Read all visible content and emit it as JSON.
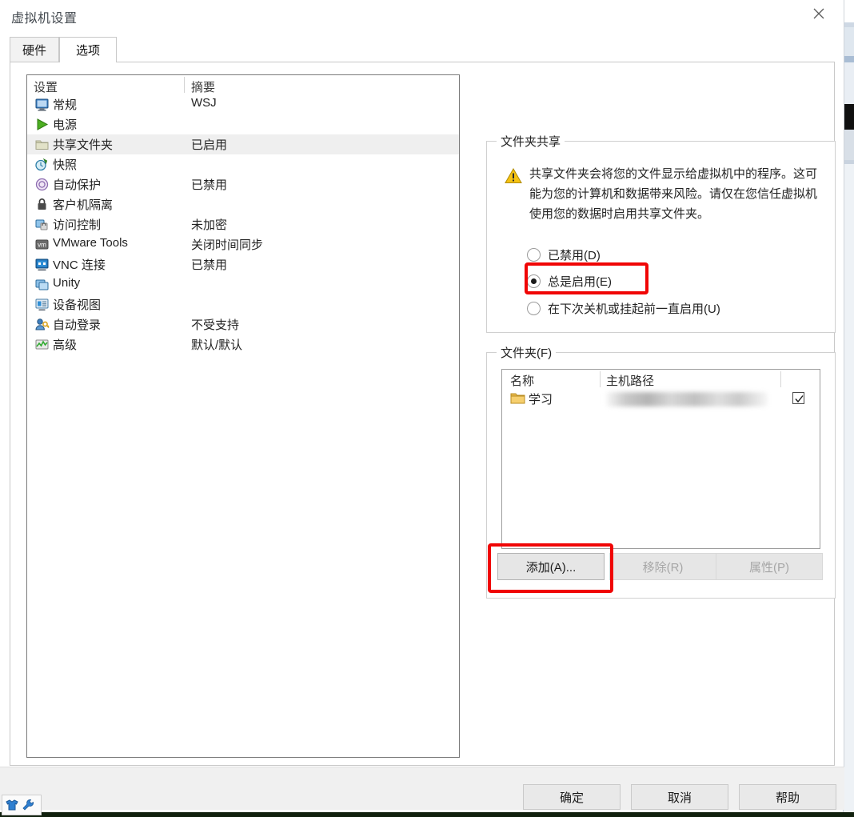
{
  "window": {
    "title": "虚拟机设置",
    "close_label": "✕"
  },
  "tabs": [
    {
      "label": "硬件",
      "active": false
    },
    {
      "label": "选项",
      "active": true
    }
  ],
  "settings_list": {
    "columns": [
      "设置",
      "摘要"
    ],
    "rows": [
      {
        "icon": "monitor-icon",
        "name": "常规",
        "summary": "WSJ",
        "selected": false
      },
      {
        "icon": "power-play-icon",
        "name": "电源",
        "summary": "",
        "selected": false
      },
      {
        "icon": "shared-folder-icon",
        "name": "共享文件夹",
        "summary": "已启用",
        "selected": true
      },
      {
        "icon": "snapshot-clock-icon",
        "name": "快照",
        "summary": "",
        "selected": false
      },
      {
        "icon": "autoprotect-icon",
        "name": "自动保护",
        "summary": "已禁用",
        "selected": false
      },
      {
        "icon": "lock-icon",
        "name": "客户机隔离",
        "summary": "",
        "selected": false
      },
      {
        "icon": "access-control-icon",
        "name": "访问控制",
        "summary": "未加密",
        "selected": false
      },
      {
        "icon": "vmware-tools-icon",
        "name": "VMware Tools",
        "summary": "关闭时间同步",
        "selected": false
      },
      {
        "icon": "vnc-monitor-icon",
        "name": "VNC 连接",
        "summary": "已禁用",
        "selected": false
      },
      {
        "icon": "unity-windows-icon",
        "name": "Unity",
        "summary": "",
        "selected": false
      },
      {
        "icon": "device-view-icon",
        "name": "设备视图",
        "summary": "",
        "selected": false
      },
      {
        "icon": "autologon-key-icon",
        "name": "自动登录",
        "summary": "不受支持",
        "selected": false
      },
      {
        "icon": "advanced-chart-icon",
        "name": "高级",
        "summary": "默认/默认",
        "selected": false
      }
    ]
  },
  "folder_sharing": {
    "legend": "文件夹共享",
    "warning_icon": "warning-triangle-icon",
    "warning_text": "共享文件夹会将您的文件显示给虚拟机中的程序。这可能为您的计算机和数据带来风险。请仅在您信任虚拟机使用您的数据时启用共享文件夹。",
    "options": [
      {
        "label": "已禁用(D)",
        "selected": false
      },
      {
        "label": "总是启用(E)",
        "selected": true
      },
      {
        "label": "在下次关机或挂起前一直启用(U)",
        "selected": false
      }
    ]
  },
  "folders": {
    "legend": "文件夹(F)",
    "columns": [
      "名称",
      "主机路径"
    ],
    "rows": [
      {
        "icon": "folder-icon",
        "name": "学习",
        "host_path": "",
        "enabled": true
      }
    ],
    "buttons": [
      {
        "label": "添加(A)...",
        "enabled": true
      },
      {
        "label": "移除(R)",
        "enabled": false
      },
      {
        "label": "属性(P)",
        "enabled": false
      }
    ]
  },
  "footer": {
    "ok": "确定",
    "cancel": "取消",
    "help": "帮助"
  },
  "annotations": {
    "highlight_color": "#f00505",
    "boxes": [
      "总是启用(E)",
      "添加(A)..."
    ]
  },
  "mini_toolbar": {
    "icons": [
      "shirt-icon",
      "wrench-icon"
    ]
  }
}
